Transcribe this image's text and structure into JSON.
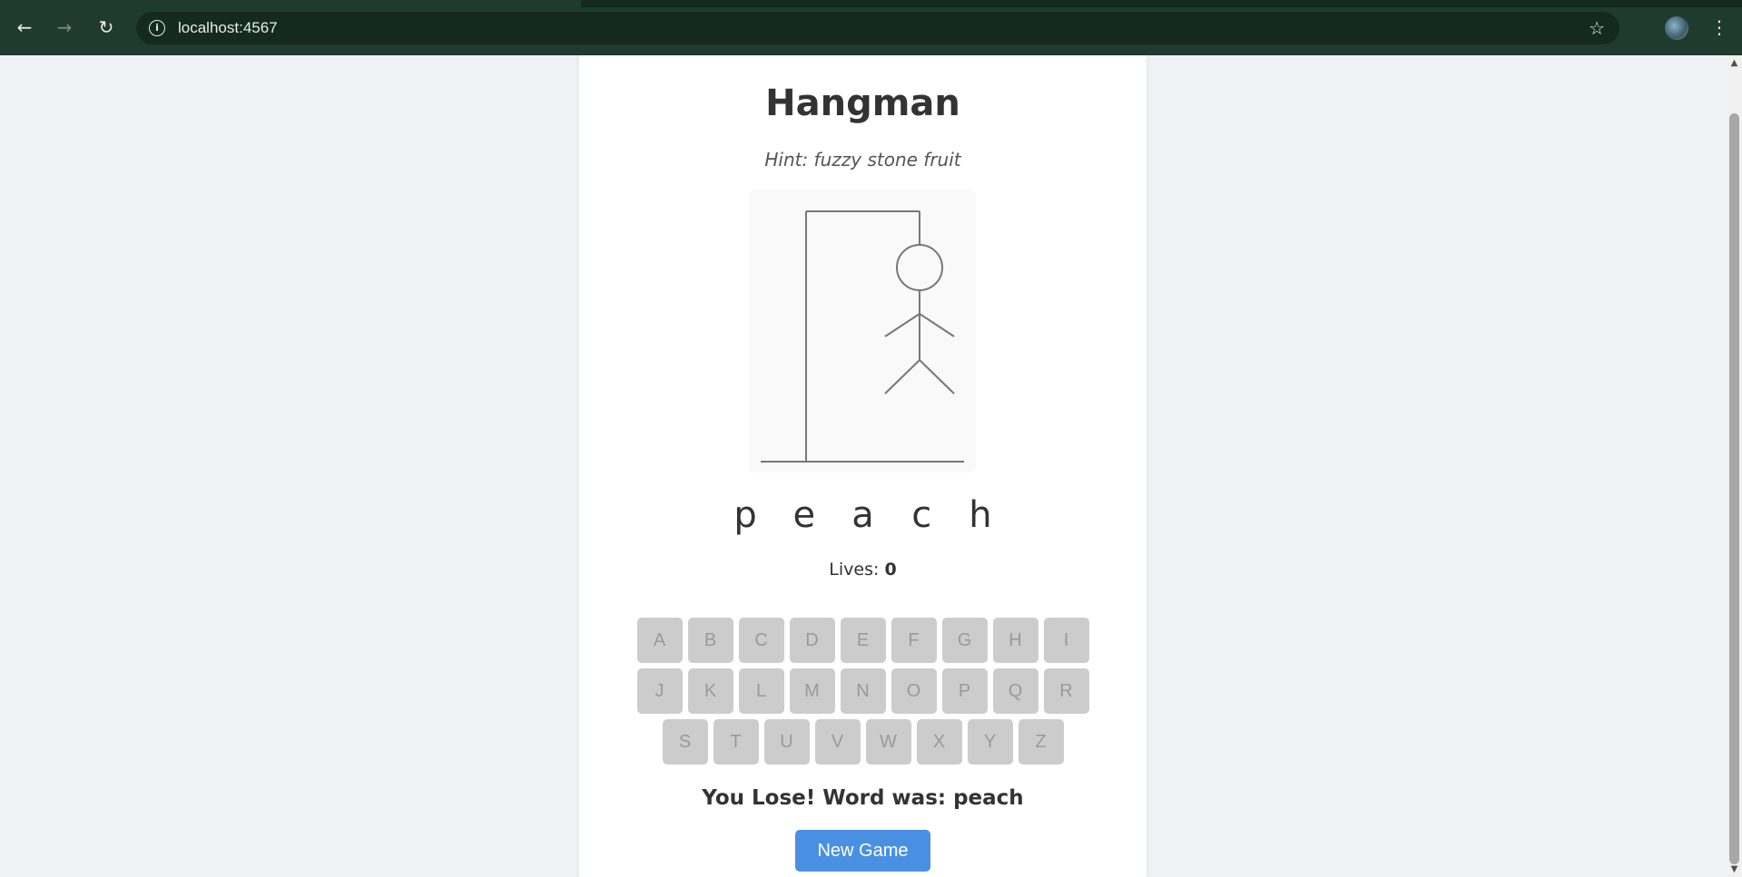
{
  "browser": {
    "url": "localhost:4567",
    "back_icon": "arrow-left-icon",
    "forward_icon": "arrow-right-icon",
    "reload_icon": "reload-icon",
    "star_icon": "star-icon",
    "menu_icon": "kebab-menu-icon"
  },
  "game": {
    "title": "Hangman",
    "hint": "Hint: fuzzy stone fruit",
    "word_letters": [
      "p",
      "e",
      "a",
      "c",
      "h"
    ],
    "lives_label": "Lives:",
    "lives_value": "0",
    "keyboard_rows": [
      [
        "A",
        "B",
        "C",
        "D",
        "E",
        "F",
        "G",
        "H",
        "I"
      ],
      [
        "J",
        "K",
        "L",
        "M",
        "N",
        "O",
        "P",
        "Q",
        "R"
      ],
      [
        "S",
        "T",
        "U",
        "V",
        "W",
        "X",
        "Y",
        "Z"
      ]
    ],
    "result": "You Lose! Word was: peach",
    "new_game_label": "New Game"
  },
  "colors": {
    "page_bg": "#f0f2f5",
    "key_disabled": "#cccccc",
    "button_primary": "#4a90e2",
    "chrome": "#1f3a2e"
  }
}
